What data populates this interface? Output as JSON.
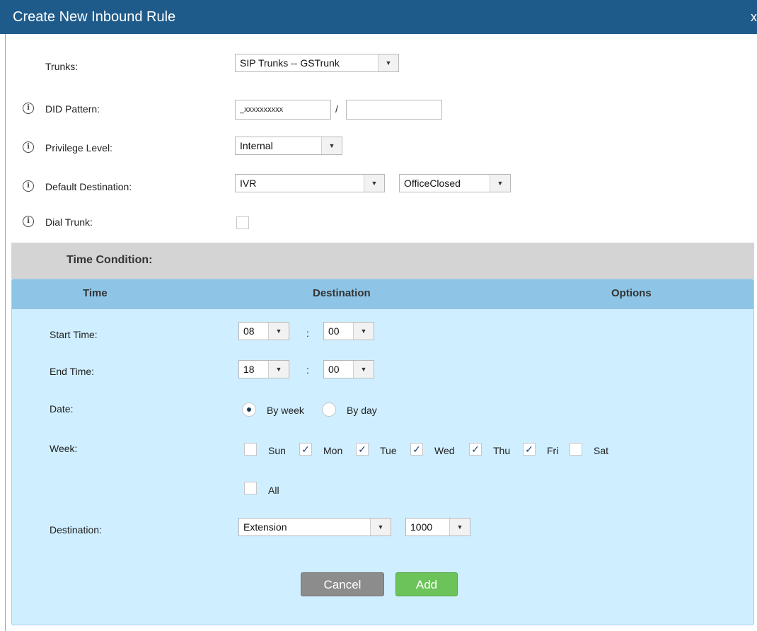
{
  "dialog": {
    "title": "Create New Inbound Rule",
    "close_label": "x"
  },
  "form": {
    "trunks": {
      "label": "Trunks:",
      "value": "SIP Trunks -- GSTrunk"
    },
    "did_pattern": {
      "label": "DID Pattern:",
      "value": "_xxxxxxxxxx",
      "separator": "/",
      "value2": ""
    },
    "privilege_level": {
      "label": "Privilege Level:",
      "value": "Internal"
    },
    "default_destination": {
      "label": "Default Destination:",
      "type": "IVR",
      "target": "OfficeClosed"
    },
    "dial_trunk": {
      "label": "Dial Trunk:",
      "checked": false
    }
  },
  "time_condition": {
    "title": "Time Condition:",
    "columns": [
      "Time",
      "Destination",
      "Options"
    ],
    "start_time": {
      "label": "Start Time:",
      "hour": "08",
      "minute": "00",
      "separator": ":"
    },
    "end_time": {
      "label": "End Time:",
      "hour": "18",
      "minute": "00",
      "separator": ":"
    },
    "date": {
      "label": "Date:",
      "by_week": "By week",
      "by_day": "By day",
      "selected": "By week"
    },
    "week": {
      "label": "Week:",
      "days": [
        {
          "name": "Sun",
          "checked": false
        },
        {
          "name": "Mon",
          "checked": true
        },
        {
          "name": "Tue",
          "checked": true
        },
        {
          "name": "Wed",
          "checked": true
        },
        {
          "name": "Thu",
          "checked": true
        },
        {
          "name": "Fri",
          "checked": true
        },
        {
          "name": "Sat",
          "checked": false
        }
      ],
      "all_label": "All",
      "all_checked": false
    },
    "destination": {
      "label": "Destination:",
      "type": "Extension",
      "target": "1000"
    }
  },
  "buttons": {
    "cancel": "Cancel",
    "add": "Add"
  },
  "icons": {
    "info": "info-icon",
    "dropdown": "caret-down-icon",
    "check": "checkmark-icon",
    "close": "close-icon"
  },
  "colors": {
    "titlebar": "#1f5b8a",
    "panel": "#cfeeff",
    "panel_header": "#8ec5e6",
    "add_button": "#6cc35a",
    "cancel_button": "#8c8c8c"
  }
}
